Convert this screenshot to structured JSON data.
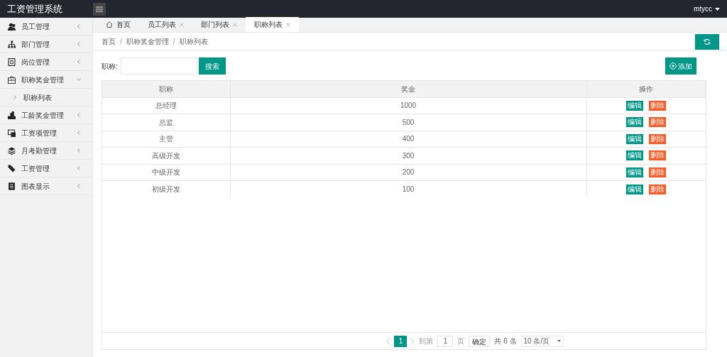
{
  "app": {
    "title": "工资管理系统",
    "user": "mtycc"
  },
  "sidebar": {
    "items": [
      {
        "label": "员工管理",
        "expanded": false
      },
      {
        "label": "部门管理",
        "expanded": false
      },
      {
        "label": "岗位管理",
        "expanded": false
      },
      {
        "label": "职称奖金管理",
        "expanded": true,
        "children": [
          {
            "label": "职称列表"
          }
        ]
      },
      {
        "label": "工龄奖金管理",
        "expanded": false
      },
      {
        "label": "工资项管理",
        "expanded": false
      },
      {
        "label": "月考勤管理",
        "expanded": false
      },
      {
        "label": "工资管理",
        "expanded": false
      },
      {
        "label": "图表显示",
        "expanded": false
      }
    ]
  },
  "tabs": [
    {
      "label": "首页",
      "kind": "home",
      "selected": false
    },
    {
      "label": "员工列表",
      "kind": "closable",
      "selected": false
    },
    {
      "label": "部门列表",
      "kind": "closable",
      "selected": false
    },
    {
      "label": "职称列表",
      "kind": "closable",
      "selected": true
    }
  ],
  "breadcrumb": [
    {
      "kind": "link",
      "label": "首页"
    },
    {
      "kind": "separator",
      "label": "/"
    },
    {
      "kind": "link",
      "label": "职称奖金管理"
    },
    {
      "kind": "separator",
      "label": "/"
    },
    {
      "kind": "link",
      "label": "职称列表"
    }
  ],
  "search": {
    "label": "职称:",
    "button": "搜索"
  },
  "add_button": "添加",
  "table": {
    "columns": [
      "职称",
      "奖金",
      "操作"
    ],
    "rows": [
      {
        "title": "总经理",
        "bonus": "1000",
        "actions": [
          "编辑",
          "删除"
        ]
      },
      {
        "title": "总监",
        "bonus": "500",
        "actions": [
          "编辑",
          "删除"
        ]
      },
      {
        "title": "主管",
        "bonus": "400",
        "actions": [
          "编辑",
          "删除"
        ]
      },
      {
        "title": "高级开发",
        "bonus": "300",
        "actions": [
          "编辑",
          "删除"
        ]
      },
      {
        "title": "中级开发",
        "bonus": "200",
        "actions": [
          "编辑",
          "删除"
        ]
      },
      {
        "title": "初级开发",
        "bonus": "100",
        "actions": [
          "编辑",
          "删除"
        ]
      }
    ]
  },
  "pagination": {
    "pages": [
      {
        "label": "1",
        "selected": true
      }
    ],
    "goto_label": "到第",
    "goto_value": "1",
    "page_unit": "页",
    "confirm": "确定",
    "total": "共 6 条",
    "page_size": "10 条/页"
  }
}
